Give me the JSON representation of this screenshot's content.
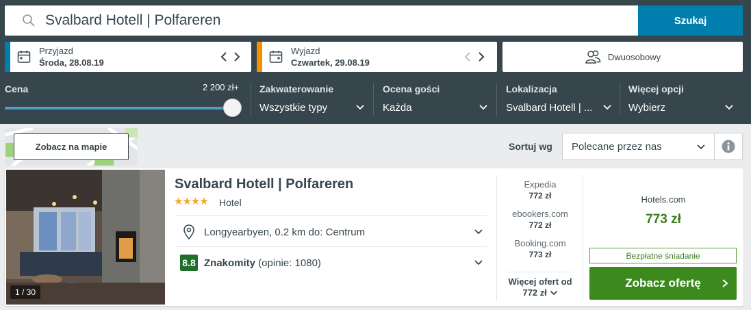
{
  "search": {
    "query": "Svalbard Hotell | Polfareren",
    "button_label": "Szukaj"
  },
  "dates": {
    "checkin": {
      "label": "Przyjazd",
      "value": "Środa, 28.08.19",
      "stripe_color": "#007faf"
    },
    "checkout": {
      "label": "Wyjazd",
      "value": "Czwartek, 29.08.19",
      "stripe_color": "#f48f00"
    }
  },
  "room": {
    "label": "Dwuosobowy"
  },
  "filters": {
    "price": {
      "label": "Cena",
      "max_label": "2 200 zł+"
    },
    "accommodation": {
      "label": "Zakwaterowanie",
      "value": "Wszystkie typy"
    },
    "guest_rating": {
      "label": "Ocena gości",
      "value": "Każda"
    },
    "location": {
      "label": "Lokalizacja",
      "value": "Svalbard Hotell | ..."
    },
    "more": {
      "label": "Więcej opcji",
      "value": "Wybierz"
    }
  },
  "toolbar": {
    "map_button": "Zobacz na mapie",
    "sort_label": "Sortuj wg",
    "sort_value": "Polecane przez nas"
  },
  "hotel": {
    "name": "Svalbard Hotell | Polfareren",
    "stars_text": "★★★★",
    "type": "Hotel",
    "location": "Longyearbyen, 0.2 km do: Centrum",
    "rating_score": "8.8",
    "rating_word": "Znakomity",
    "rating_reviews": "(opinie: 1080)",
    "photo_counter": "1 / 30",
    "providers": [
      {
        "name": "Expedia",
        "price": "772 zł"
      },
      {
        "name": "ebookers.com",
        "price": "772 zł"
      },
      {
        "name": "Booking.com",
        "price": "773 zł"
      }
    ],
    "more_offers_label": "Więcej ofert od",
    "more_offers_price": "772 zł",
    "best": {
      "provider": "Hotels.com",
      "price": "773 zł",
      "perk": "Bezpłatne śniadanie",
      "button": "Zobacz ofertę"
    }
  }
}
